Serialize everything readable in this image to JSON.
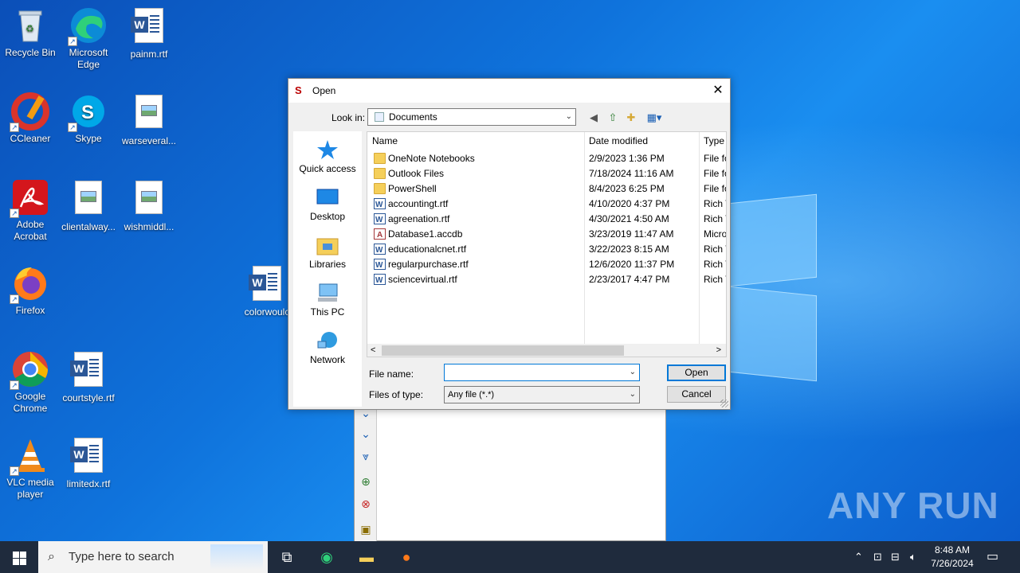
{
  "desktop": {
    "icons": [
      {
        "label": "Recycle Bin",
        "icon": "recycle-bin-icon"
      },
      {
        "label": "Microsoft Edge",
        "icon": "edge-icon"
      },
      {
        "label": "painm.rtf",
        "icon": "word-doc-icon"
      },
      {
        "label": "CCleaner",
        "icon": "ccleaner-icon"
      },
      {
        "label": "Skype",
        "icon": "skype-icon"
      },
      {
        "label": "warseveral...",
        "icon": "image-file-icon"
      },
      {
        "label": "Adobe Acrobat",
        "icon": "acrobat-icon"
      },
      {
        "label": "clientalway...",
        "icon": "image-file-icon"
      },
      {
        "label": "wishmiddl...",
        "icon": "image-file-icon"
      },
      {
        "label": "Firefox",
        "icon": "firefox-icon"
      },
      {
        "label": "colorwoulc",
        "icon": "word-doc-icon"
      },
      {
        "label": "Google Chrome",
        "icon": "chrome-icon"
      },
      {
        "label": "courtstyle.rtf",
        "icon": "word-doc-icon"
      },
      {
        "label": "VLC media player",
        "icon": "vlc-icon"
      },
      {
        "label": "limitedx.rtf",
        "icon": "word-doc-icon"
      }
    ],
    "watermark": "ANY RUN"
  },
  "dialog": {
    "title": "Open",
    "look_in_label": "Look in:",
    "look_in_value": "Documents",
    "places": [
      "Quick access",
      "Desktop",
      "Libraries",
      "This PC",
      "Network"
    ],
    "columns": [
      "Name",
      "Date modified",
      "Type"
    ],
    "files": [
      {
        "name": "OneNote Notebooks",
        "date": "2/9/2023 1:36 PM",
        "type": "File fo",
        "kind": "folder"
      },
      {
        "name": "Outlook Files",
        "date": "7/18/2024 11:16 AM",
        "type": "File fo",
        "kind": "folder"
      },
      {
        "name": "PowerShell",
        "date": "8/4/2023 6:25 PM",
        "type": "File fo",
        "kind": "folder"
      },
      {
        "name": "accountingt.rtf",
        "date": "4/10/2020 4:37 PM",
        "type": "Rich T",
        "kind": "rtf"
      },
      {
        "name": "agreenation.rtf",
        "date": "4/30/2021 4:50 AM",
        "type": "Rich T",
        "kind": "rtf"
      },
      {
        "name": "Database1.accdb",
        "date": "3/23/2019 11:47 AM",
        "type": "Micro",
        "kind": "accdb"
      },
      {
        "name": "educationalcnet.rtf",
        "date": "3/22/2023 8:15 AM",
        "type": "Rich T",
        "kind": "rtf"
      },
      {
        "name": "regularpurchase.rtf",
        "date": "12/6/2020 11:37 PM",
        "type": "Rich T",
        "kind": "rtf"
      },
      {
        "name": "sciencevirtual.rtf",
        "date": "2/23/2017 4:47 PM",
        "type": "Rich T",
        "kind": "rtf"
      }
    ],
    "file_name_label": "File name:",
    "file_name_value": "",
    "file_type_label": "Files of type:",
    "file_type_value": "Any file (*.*)",
    "open_label": "Open",
    "cancel_label": "Cancel"
  },
  "taskbar": {
    "search_placeholder": "Type here to search",
    "time": "8:48 AM",
    "date": "7/26/2024"
  }
}
